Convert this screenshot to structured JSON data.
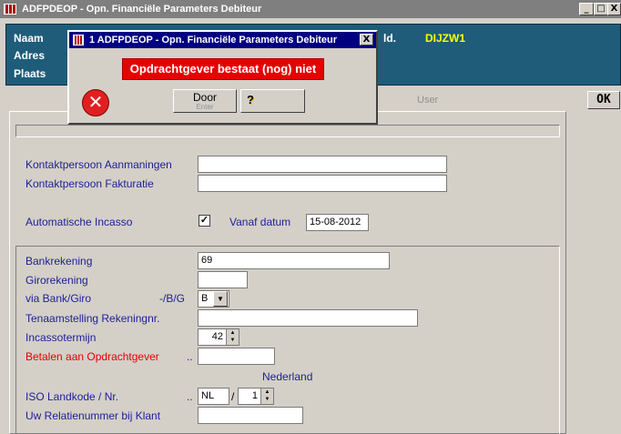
{
  "window": {
    "title": "ADFPDEOP - Opn. Financiële Parameters Debiteur",
    "buttons": {
      "minimize": "_",
      "maximize": "□",
      "close": "X"
    }
  },
  "header": {
    "name_label": "Naam",
    "address_label": "Adres",
    "city_label": "Plaats",
    "id_label": "ld.",
    "id_value": "DIJZW1"
  },
  "tabs": {
    "user": "User"
  },
  "ok_button": "OK",
  "form": {
    "contact_reminders_label": "Kontaktpersoon Aanmaningen",
    "contact_reminders_value": "",
    "contact_invoicing_label": "Kontaktpersoon Fakturatie",
    "contact_invoicing_value": "",
    "auto_collection_label": "Automatische Incasso",
    "auto_collection_checked": "✓",
    "from_date_label": "Vanaf datum",
    "from_date_value": "15-08-2012",
    "bank_account_label": "Bankrekening",
    "bank_account_value": "69",
    "giro_account_label": "Girorekening",
    "giro_account_value": "",
    "via_bank_giro_label": "via Bank/Giro",
    "via_bank_giro_hint": "-/B/G",
    "via_bank_giro_value": "B",
    "account_name_label": "Tenaamstelling Rekeningnr.",
    "account_name_value": "",
    "collection_term_label": "Incassotermijn",
    "collection_term_value": "42",
    "pay_to_client_label": "Betalen aan Opdrachtgever",
    "pay_to_client_dots": "..",
    "pay_to_client_value": "",
    "country_name": "Nederland",
    "iso_country_label": "ISO Landkode / Nr.",
    "iso_country_dots": "..",
    "iso_country_code": "NL",
    "iso_separator": "/",
    "iso_number": "1",
    "client_relation_label": "Uw Relatienummer bij Klant",
    "client_relation_value": ""
  },
  "dialog": {
    "title": "1 ADFPDEOP - Opn. Financiële Parameters Debiteur",
    "close": "X",
    "message": "Opdrachtgever bestaat (nog) niet",
    "continue_label": "Door",
    "continue_sub": "Enter",
    "help_icon": "?"
  },
  "colors": {
    "header_bg": "#1f5c7a",
    "label_blue": "#1e1e96",
    "error_red": "#e60000",
    "dialog_title_bg": "#000080"
  }
}
